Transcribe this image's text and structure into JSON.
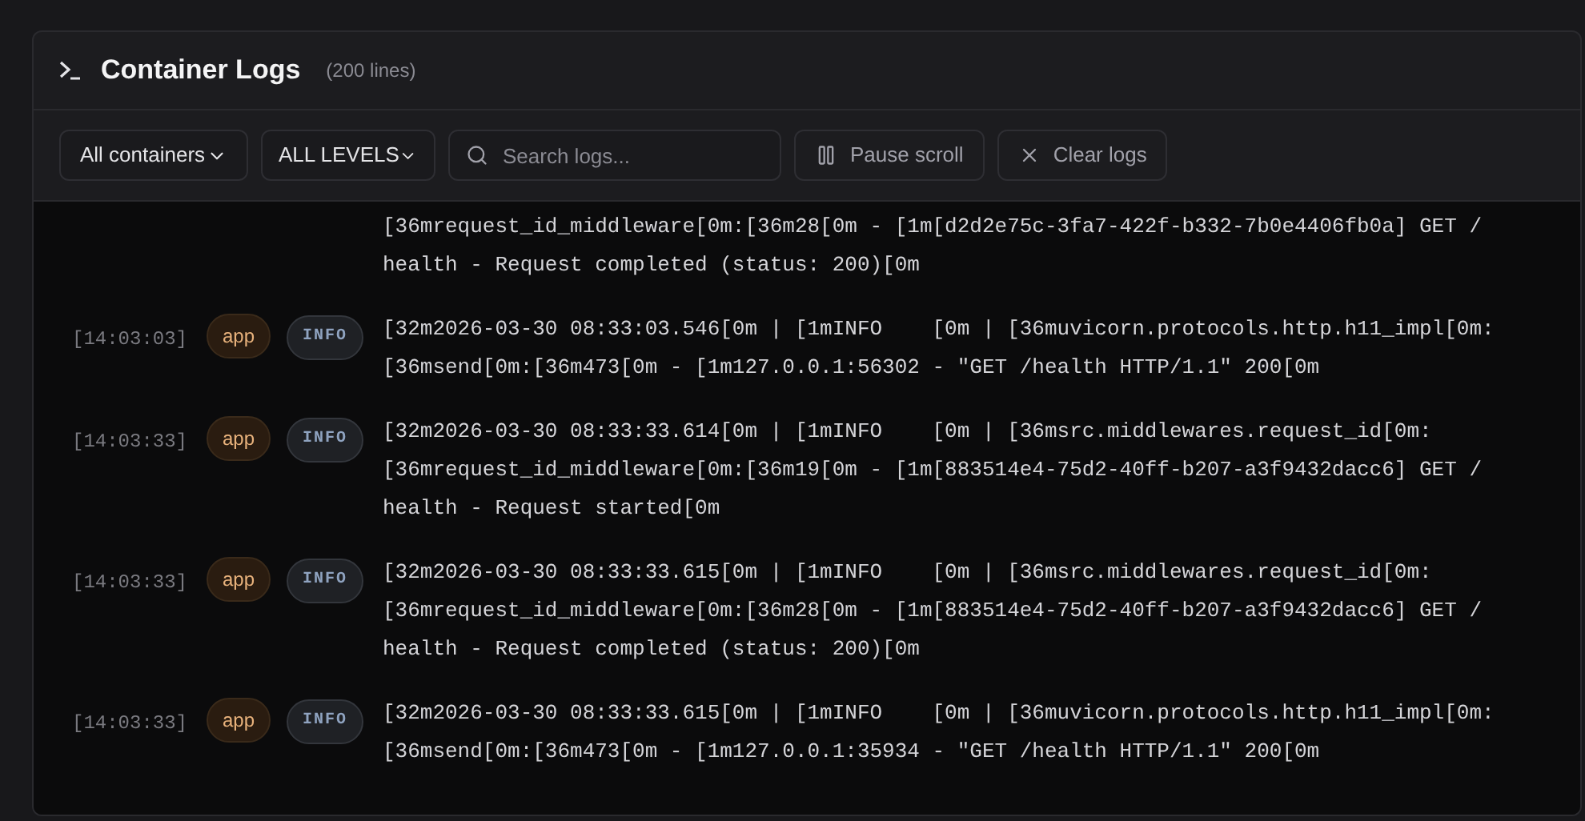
{
  "header": {
    "title": "Container Logs",
    "count": "(200 lines)"
  },
  "toolbar": {
    "container_filter": "All containers",
    "level_filter": "ALL LEVELS",
    "search": {
      "placeholder": "Search logs..."
    },
    "buttons": [
      {
        "kind": "pause",
        "label": "Pause scroll"
      },
      {
        "kind": "clear",
        "label": "Clear logs"
      }
    ]
  },
  "logs": [
    {
      "lines": [
        "[36mrequest_id_middleware[0m:[36m28[0m - [1m[d2d2e75c-3fa7-422f-b332-7b0e4406fb0a] GET /",
        "health - Request completed (status: 200)[0m"
      ]
    },
    {
      "time": "[14:03:03]",
      "source": "app",
      "level": "INFO",
      "lines": [
        "[32m2026-03-30 08:33:03.546[0m | [1mINFO    [0m | [36muvicorn.protocols.http.h11_impl[0m:",
        "[36msend[0m:[36m473[0m - [1m127.0.0.1:56302 - \"GET /health HTTP/1.1\" 200[0m"
      ]
    },
    {
      "time": "[14:03:33]",
      "source": "app",
      "level": "INFO",
      "lines": [
        "[32m2026-03-30 08:33:33.614[0m | [1mINFO    [0m | [36msrc.middlewares.request_id[0m:",
        "[36mrequest_id_middleware[0m:[36m19[0m - [1m[883514e4-75d2-40ff-b207-a3f9432dacc6] GET /",
        "health - Request started[0m"
      ]
    },
    {
      "time": "[14:03:33]",
      "source": "app",
      "level": "INFO",
      "lines": [
        "[32m2026-03-30 08:33:33.615[0m | [1mINFO    [0m | [36msrc.middlewares.request_id[0m:",
        "[36mrequest_id_middleware[0m:[36m28[0m - [1m[883514e4-75d2-40ff-b207-a3f9432dacc6] GET /",
        "health - Request completed (status: 200)[0m"
      ]
    },
    {
      "time": "[14:03:33]",
      "source": "app",
      "level": "INFO",
      "lines": [
        "[32m2026-03-30 08:33:33.615[0m | [1mINFO    [0m | [36muvicorn.protocols.http.h11_impl[0m:",
        "[36msend[0m:[36m473[0m - [1m127.0.0.1:35934 - \"GET /health HTTP/1.1\" 200[0m"
      ]
    }
  ]
}
